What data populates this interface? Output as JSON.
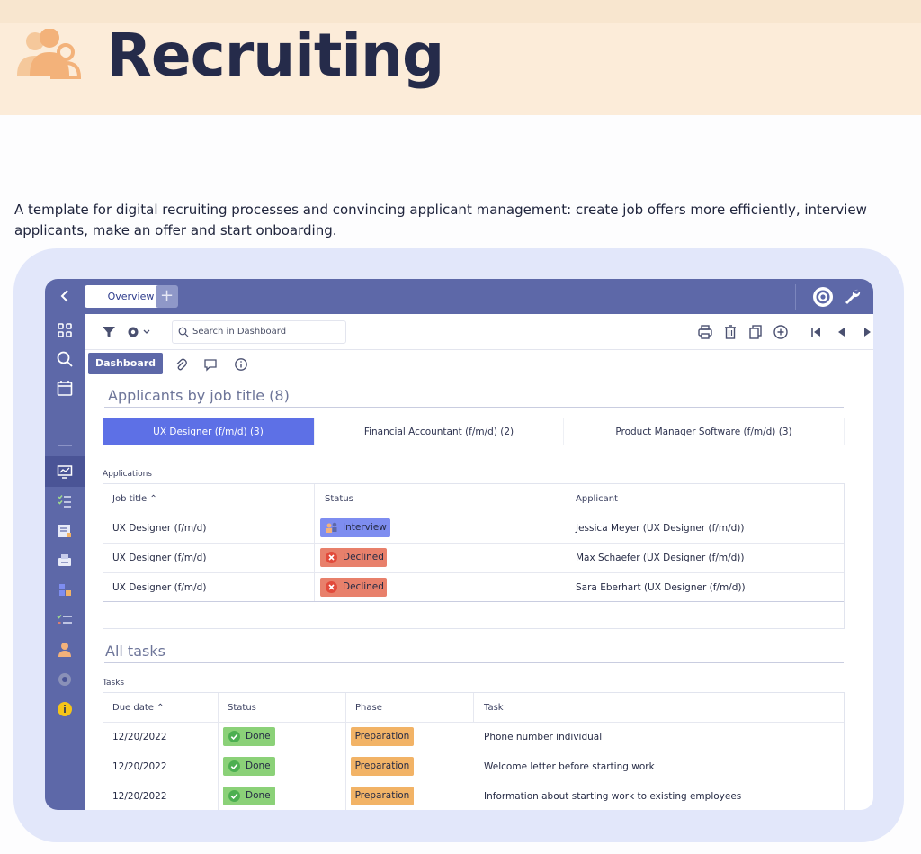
{
  "hero": {
    "title": "Recruiting",
    "icon": "people-group-icon"
  },
  "description": "A template for digital recruiting processes and convincing applicant management: create job offers more efficiently, interview applicants, make an offer and start onboarding.",
  "app": {
    "tabs": [
      {
        "label": "Overview"
      },
      {
        "label": "+"
      }
    ],
    "search": {
      "placeholder": "Search in Dashboard"
    },
    "subtab_label": "Dashboard",
    "applicants_section": {
      "title": "Applicants by job title (8)",
      "job_tabs": [
        {
          "label": "UX Designer (f/m/d) (3)",
          "active": true
        },
        {
          "label": "Financial Accountant (f/m/d) (2)",
          "active": false
        },
        {
          "label": "Product Manager Software (f/m/d) (3)",
          "active": false
        }
      ],
      "table_label": "Applications",
      "headers": [
        "Job title ⌃",
        "Status",
        "Applicant"
      ],
      "rows": [
        {
          "job": "UX Designer (f/m/d)",
          "status": "Interview",
          "applicant": "Jessica Meyer (UX Designer (f/m/d))"
        },
        {
          "job": "UX Designer (f/m/d)",
          "status": "Declined",
          "applicant": "Max Schaefer (UX Designer (f/m/d))"
        },
        {
          "job": "UX Designer (f/m/d)",
          "status": "Declined",
          "applicant": "Sara Eberhart (UX Designer (f/m/d))"
        }
      ]
    },
    "tasks_section": {
      "title": "All tasks",
      "table_label": "Tasks",
      "headers": [
        "Due date ⌃",
        "Status",
        "Phase",
        "Task"
      ],
      "rows": [
        {
          "due": "12/20/2022",
          "status": "Done",
          "phase": "Preparation",
          "task": "Phone number individual"
        },
        {
          "due": "12/20/2022",
          "status": "Done",
          "phase": "Preparation",
          "task": "Welcome letter before starting work"
        },
        {
          "due": "12/20/2022",
          "status": "Done",
          "phase": "Preparation",
          "task": "Information about starting work to existing employees"
        }
      ]
    }
  },
  "colors": {
    "accent": "#5d68a8",
    "active_tab": "#5d70e6",
    "interview": "#7e8df0",
    "declined": "#e8806b",
    "done": "#8bd178",
    "preparation": "#f2b366"
  }
}
